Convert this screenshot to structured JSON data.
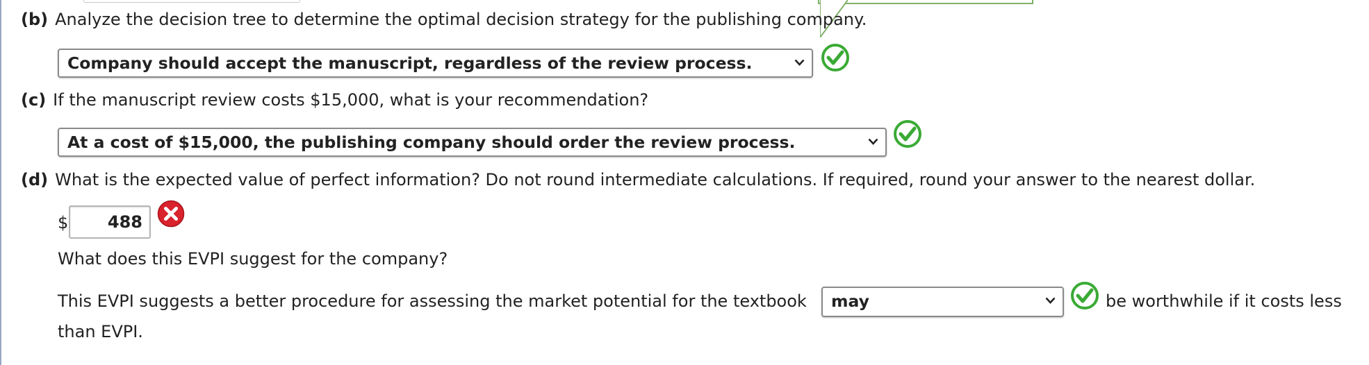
{
  "questions": {
    "b": {
      "label": "(b)",
      "text": "Analyze the decision tree to determine the optimal decision strategy for the publishing company.",
      "select_value": "Company should accept the manuscript, regardless of the review process."
    },
    "c": {
      "label": "(c)",
      "text": "If the manuscript review costs $15,000, what is your recommendation?",
      "select_value": "At a cost of $15,000, the publishing company should order the review process."
    },
    "d": {
      "label": "(d)",
      "text": "What is the expected value of perfect information? Do not round intermediate calculations. If required, round your answer to the nearest dollar.",
      "currency": "$",
      "answer_value": "488",
      "followup": "What does this EVPI suggest for the company?",
      "sentence_before": "This EVPI suggests a better procedure for assessing the market potential for the textbook",
      "select_value": "may",
      "sentence_after": "be worthwhile if it costs less",
      "sentence_end": "than EVPI."
    }
  },
  "icons": {
    "correct": "check-circle-icon",
    "incorrect": "x-circle-icon",
    "dropdown": "chevron-down-icon"
  },
  "colors": {
    "correct": "#3aaa35",
    "incorrect": "#d9232d",
    "tooltip_border": "#7fb069"
  }
}
